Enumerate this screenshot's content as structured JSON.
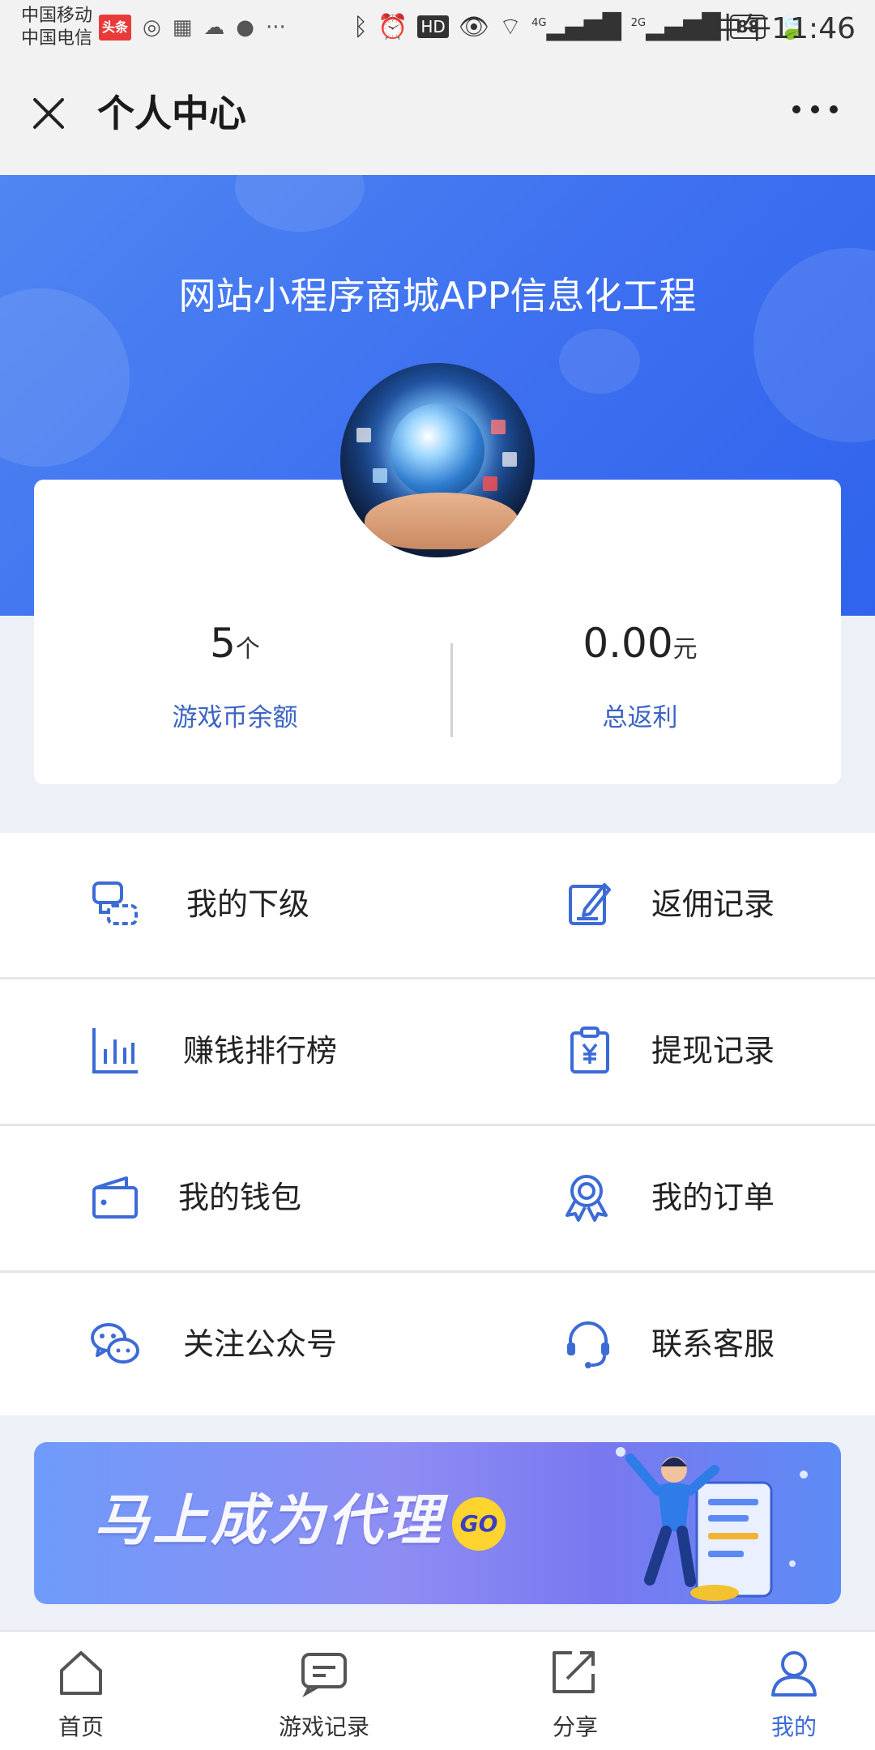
{
  "status_bar": {
    "carrier_1": "中国移动",
    "carrier_2": "中国电信",
    "news_badge": "头条",
    "network_1": "4G",
    "network_2": "2G",
    "battery": "88",
    "time": "中午11:46"
  },
  "title_bar": {
    "title": "个人中心"
  },
  "hero": {
    "store_name": "网站小程序商城APP信息化工程"
  },
  "stats": {
    "coins": {
      "value": "5",
      "unit": "个",
      "label": "游戏币余额"
    },
    "rebate": {
      "value": "0.00",
      "unit": "元",
      "label": "总返利"
    }
  },
  "menu": {
    "rows": [
      {
        "left": {
          "label": "我的下级",
          "icon": "subordinates-icon"
        },
        "right": {
          "label": "返佣记录",
          "icon": "edit-record-icon"
        }
      },
      {
        "left": {
          "label": "赚钱排行榜",
          "icon": "bar-chart-icon"
        },
        "right": {
          "label": "提现记录",
          "icon": "withdraw-clipboard-icon"
        }
      },
      {
        "left": {
          "label": "我的钱包",
          "icon": "wallet-icon"
        },
        "right": {
          "label": "我的订单",
          "icon": "badge-ribbon-icon"
        }
      },
      {
        "left": {
          "label": "关注公众号",
          "icon": "wechat-icon"
        },
        "right": {
          "label": "联系客服",
          "icon": "headset-icon"
        }
      }
    ]
  },
  "promo": {
    "text": "马上成为代理",
    "go": "GO"
  },
  "tabs": [
    {
      "label": "首页",
      "icon": "home-icon"
    },
    {
      "label": "游戏记录",
      "icon": "message-icon"
    },
    {
      "label": "分享",
      "icon": "share-icon"
    },
    {
      "label": "我的",
      "icon": "profile-icon"
    }
  ],
  "colors": {
    "accent": "#3c6bd6",
    "hero_blue": "#3d6ff0",
    "label_blue": "#3c64c4",
    "page_bg": "#eef0f8"
  }
}
